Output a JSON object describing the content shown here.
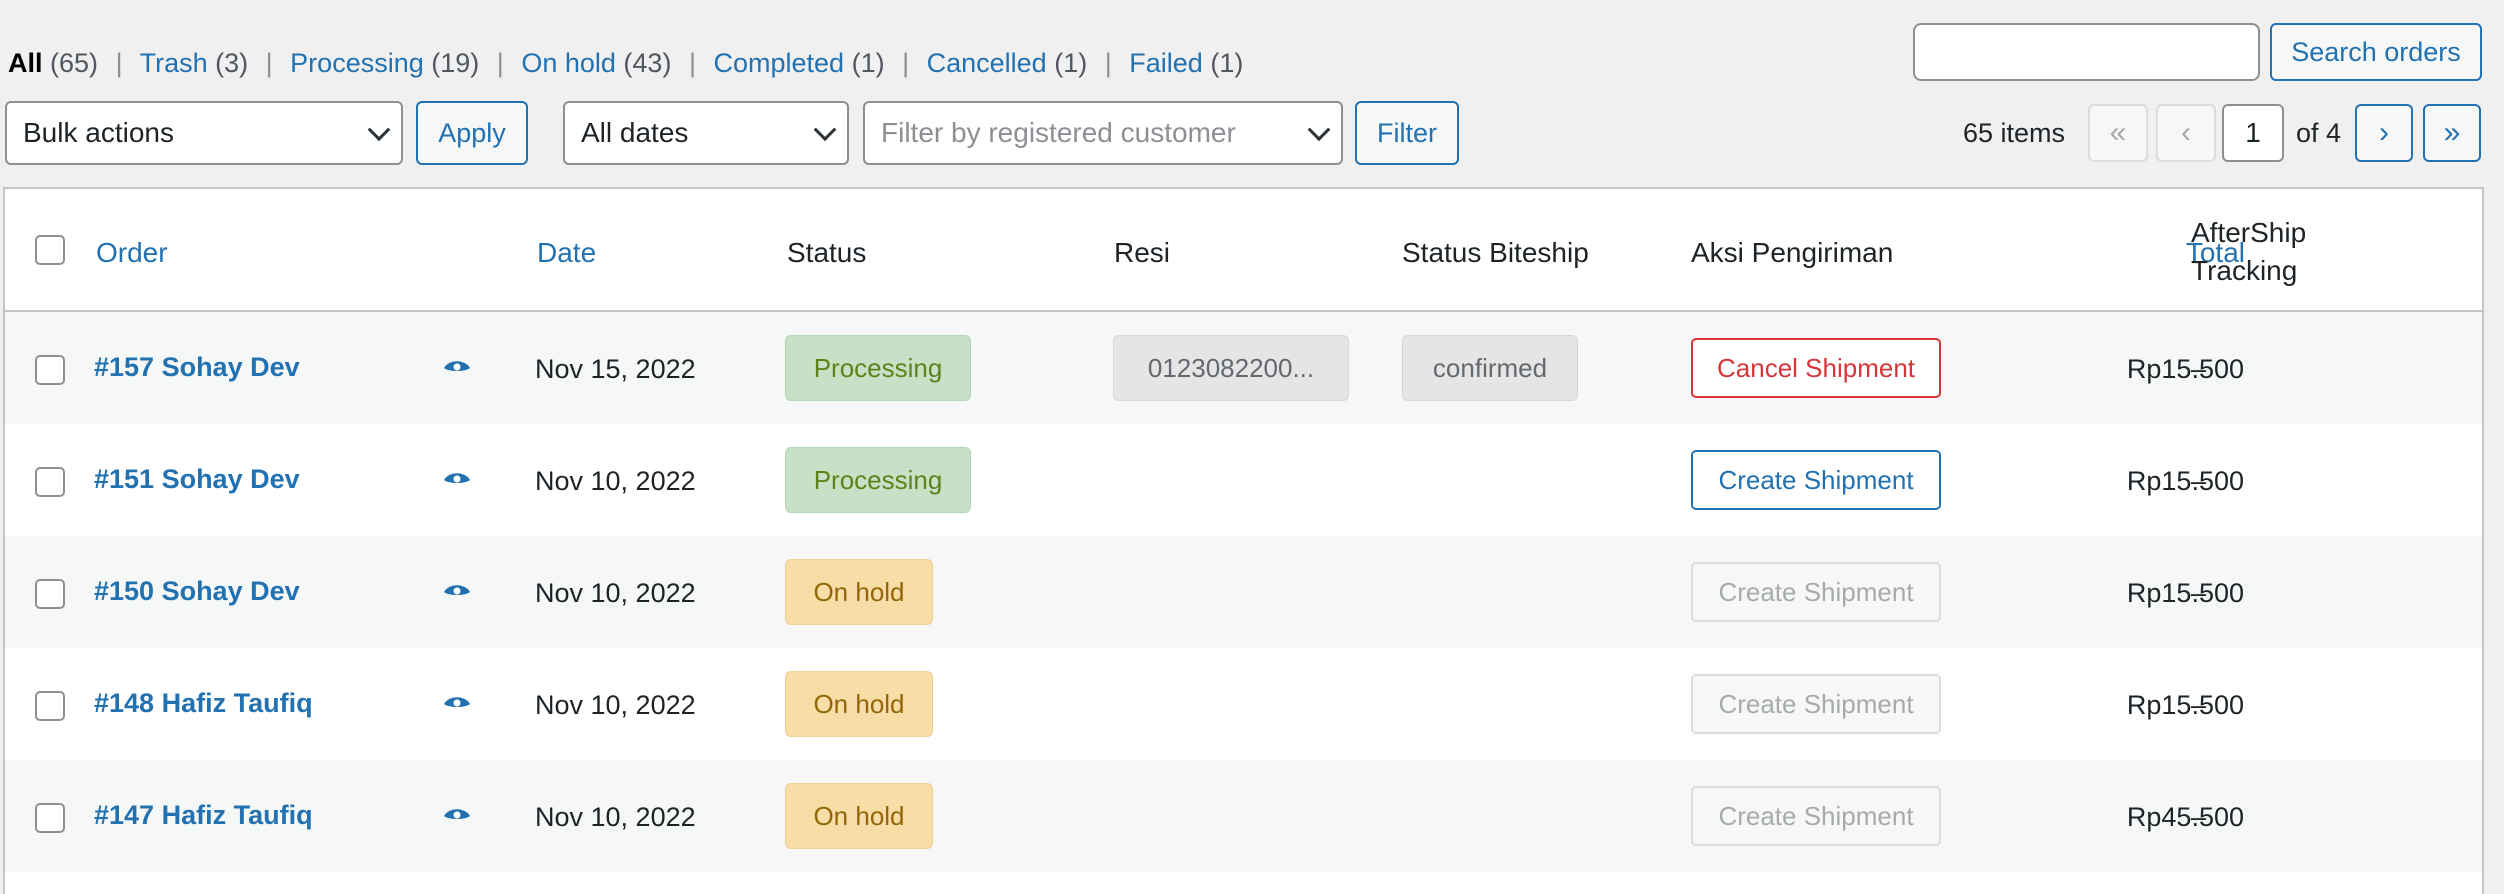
{
  "status_filters": {
    "all_label": "All",
    "all_count": "(65)",
    "trash_label": "Trash",
    "trash_count": "(3)",
    "processing_label": "Processing",
    "processing_count": "(19)",
    "onhold_label": "On hold",
    "onhold_count": "(43)",
    "completed_label": "Completed",
    "completed_count": "(1)",
    "cancelled_label": "Cancelled",
    "cancelled_count": "(1)",
    "failed_label": "Failed",
    "failed_count": "(1)",
    "separator": "|"
  },
  "search": {
    "value": "",
    "button_label": "Search orders"
  },
  "toolbar": {
    "bulk_actions": "Bulk actions",
    "apply_label": "Apply",
    "dates": "All dates",
    "customer_placeholder": "Filter by registered customer",
    "filter_label": "Filter"
  },
  "pagination": {
    "items": "65 items",
    "first": "«",
    "prev": "‹",
    "current": "1",
    "of": "of 4",
    "next": "›",
    "last": "»"
  },
  "table": {
    "headers": {
      "order": "Order",
      "date": "Date",
      "status": "Status",
      "resi": "Resi",
      "status_biteship": "Status Biteship",
      "aksi": "Aksi Pengiriman",
      "total": "Total",
      "aftership_1": "AfterShip",
      "aftership_2": "Tracking"
    },
    "rows": [
      {
        "order": "#157 Sohay Dev",
        "date": "Nov 15, 2022",
        "status": "Processing",
        "resi": "0123082200...",
        "biteship": "confirmed",
        "action": "Cancel Shipment",
        "total": "Rp15.500",
        "tracking": "–"
      },
      {
        "order": "#151 Sohay Dev",
        "date": "Nov 10, 2022",
        "status": "Processing",
        "resi": "",
        "biteship": "",
        "action": "Create Shipment",
        "total": "Rp15.500",
        "tracking": "–"
      },
      {
        "order": "#150 Sohay Dev",
        "date": "Nov 10, 2022",
        "status": "On hold",
        "resi": "",
        "biteship": "",
        "action": "Create Shipment",
        "total": "Rp15.500",
        "tracking": "–"
      },
      {
        "order": "#148 Hafiz Taufiq",
        "date": "Nov 10, 2022",
        "status": "On hold",
        "resi": "",
        "biteship": "",
        "action": "Create Shipment",
        "total": "Rp15.500",
        "tracking": "–"
      },
      {
        "order": "#147 Hafiz Taufiq",
        "date": "Nov 10, 2022",
        "status": "On hold",
        "resi": "",
        "biteship": "",
        "action": "Create Shipment",
        "total": "Rp45.500",
        "tracking": "–"
      }
    ]
  },
  "colors": {
    "link": "#2271b1",
    "processing_bg": "#c6e1c6",
    "processing_text": "#5b841b",
    "onhold_bg": "#f8dda7",
    "onhold_text": "#94660c",
    "cancel": "#d63638"
  },
  "icons": {
    "preview": "eye-icon",
    "select_arrow": "chevron-down-icon"
  }
}
